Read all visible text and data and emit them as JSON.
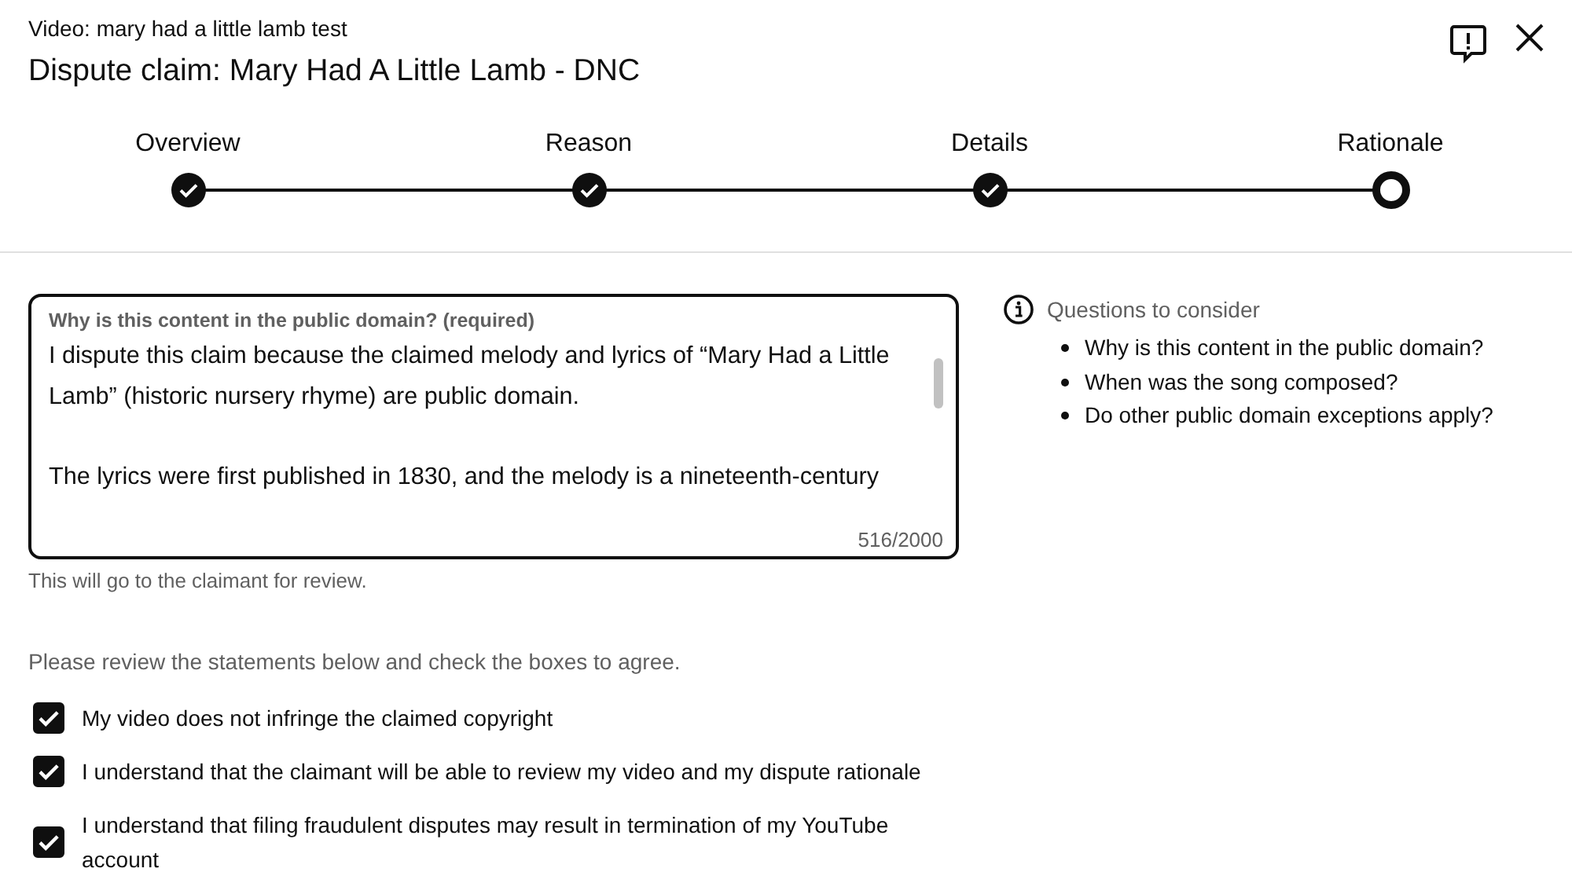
{
  "header": {
    "subtitle": "Video: mary had a little lamb test",
    "title": "Dispute claim: Mary Had A Little Lamb - DNC"
  },
  "steps": [
    {
      "label": "Overview",
      "completed": true,
      "selected": false
    },
    {
      "label": "Reason",
      "completed": true,
      "selected": false
    },
    {
      "label": "Details",
      "completed": true,
      "selected": false
    },
    {
      "label": "Rationale",
      "completed": false,
      "selected": true
    }
  ],
  "rationale_field": {
    "label": "Why is this content in the public domain? (required)",
    "value": "I dispute this claim because the claimed melody and lyrics of “Mary Had a Little Lamb” (historic nursery rhyme) are public domain.\n\nThe lyrics were first published in 1830, and the melody is a nineteenth-century",
    "counter": "516/2000",
    "helper": "This will go to the claimant for review."
  },
  "questions": {
    "title": "Questions to consider",
    "items": [
      "Why is this content in the public domain?",
      "When was the song composed?",
      "Do other public domain exceptions apply?"
    ]
  },
  "instructions": "Please review the statements below and check the boxes to agree.",
  "statements": [
    {
      "label": "My video does not infringe the claimed copyright",
      "checked": true
    },
    {
      "label": "I understand that the claimant will be able to review my video and my dispute rationale",
      "checked": true
    },
    {
      "label": "I understand that filing fraudulent disputes may result in termination of my YouTube account",
      "checked": true
    }
  ]
}
